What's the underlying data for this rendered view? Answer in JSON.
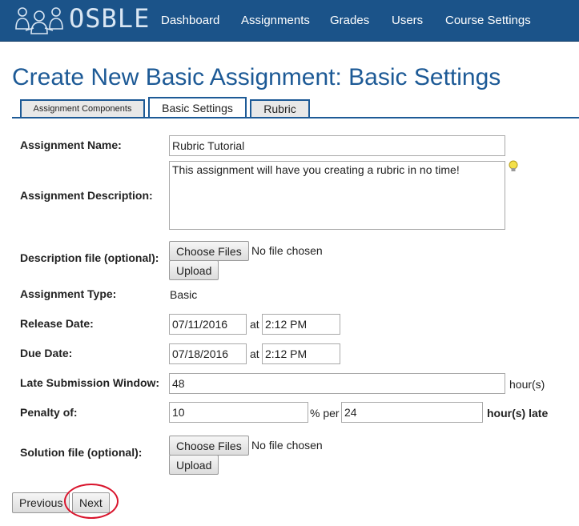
{
  "app": {
    "logo_text": "OSBLE"
  },
  "nav": {
    "items": [
      "Dashboard",
      "Assignments",
      "Grades",
      "Users",
      "Course Settings"
    ]
  },
  "page": {
    "title": "Create New Basic Assignment: Basic Settings"
  },
  "tabs": [
    {
      "label": "Assignment Components",
      "active": false
    },
    {
      "label": "Basic Settings",
      "active": true
    },
    {
      "label": "Rubric",
      "active": false
    }
  ],
  "form": {
    "name": {
      "label": "Assignment Name:",
      "value": "Rubric Tutorial"
    },
    "description": {
      "label": "Assignment Description:",
      "value": "This assignment will have you creating a rubric in no time!"
    },
    "desc_file": {
      "label": "Description file (optional):",
      "choose_label": "Choose Files",
      "status": "No file chosen",
      "upload_label": "Upload"
    },
    "type": {
      "label": "Assignment Type:",
      "value": "Basic"
    },
    "release": {
      "label": "Release Date:",
      "date": "07/11/2016",
      "at": "at",
      "time": "2:12 PM"
    },
    "due": {
      "label": "Due Date:",
      "date": "07/18/2016",
      "at": "at",
      "time": "2:12 PM"
    },
    "late_window": {
      "label": "Late Submission Window:",
      "value": "48",
      "unit": "hour(s)"
    },
    "penalty": {
      "label": "Penalty of:",
      "value": "10",
      "per": "% per",
      "hours": "24",
      "unit": "hour(s) late"
    },
    "solution_file": {
      "label": "Solution file (optional):",
      "choose_label": "Choose Files",
      "status": "No file chosen",
      "upload_label": "Upload"
    }
  },
  "footer": {
    "previous_label": "Previous",
    "next_label": "Next"
  },
  "colors": {
    "nav_bg": "#1b5389",
    "title": "#1d5a96",
    "highlight": "#d9142c"
  }
}
